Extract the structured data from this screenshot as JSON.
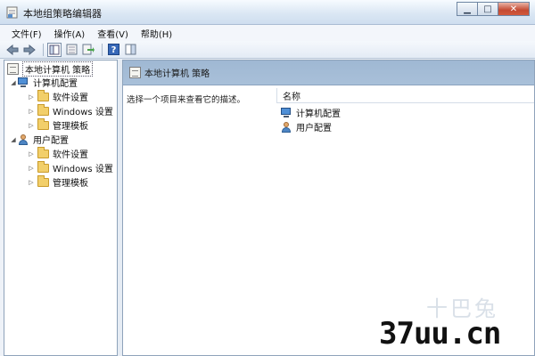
{
  "window": {
    "title": "本地组策略编辑器"
  },
  "menubar": {
    "items": [
      "文件(F)",
      "操作(A)",
      "查看(V)",
      "帮助(H)"
    ]
  },
  "toolbar": {
    "buttons": [
      "back-arrow-icon",
      "forward-arrow-icon",
      "show-hide-tree-icon",
      "properties-icon",
      "export-list-icon",
      "help-icon",
      "action-pane-icon"
    ]
  },
  "tree": {
    "root": "本地计算机 策略",
    "computer": {
      "label": "计算机配置",
      "children": [
        "软件设置",
        "Windows 设置",
        "管理模板"
      ]
    },
    "user": {
      "label": "用户配置",
      "children": [
        "软件设置",
        "Windows 设置",
        "管理模板"
      ]
    }
  },
  "main": {
    "header": "本地计算机 策略",
    "description": "选择一个项目来查看它的描述。",
    "column_name": "名称",
    "items": [
      "计算机配置",
      "用户配置"
    ]
  },
  "watermark": {
    "cn": "十巴兔",
    "site": "37uu.cn"
  }
}
